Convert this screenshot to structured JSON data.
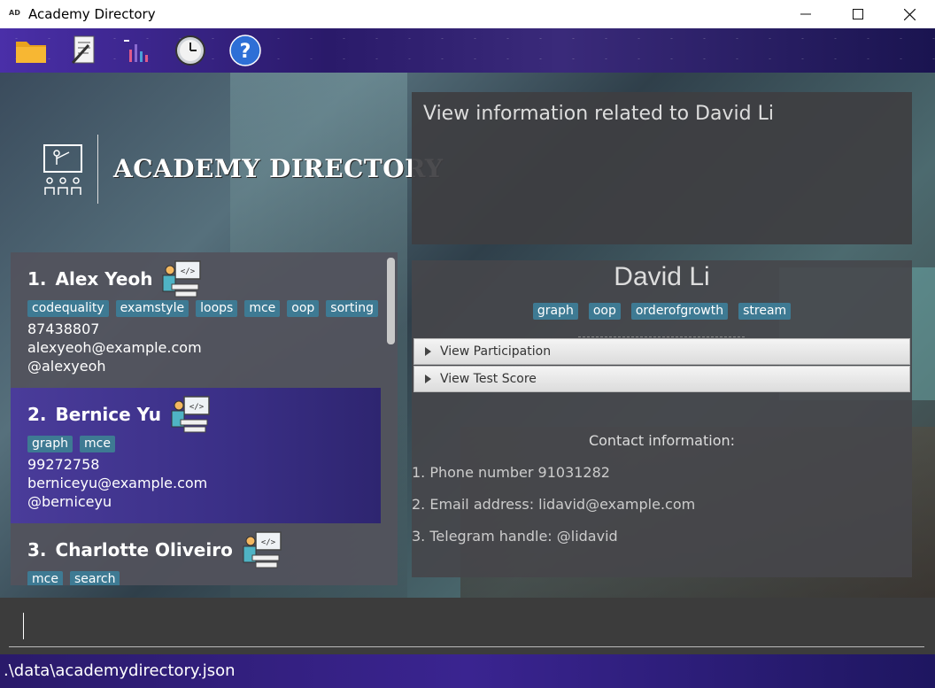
{
  "window": {
    "app_icon_text": "AD",
    "title": "Academy Directory"
  },
  "toolbar": {
    "items": [
      {
        "icon": "folder-icon"
      },
      {
        "icon": "notes-icon"
      },
      {
        "icon": "chart-icon"
      },
      {
        "icon": "clock-icon"
      },
      {
        "icon": "help-icon"
      }
    ]
  },
  "logo": {
    "text": "ACADEMY DIRECTORY"
  },
  "students": [
    {
      "index": "1.",
      "name": "Alex Yeoh",
      "tags": [
        "codequality",
        "examstyle",
        "loops",
        "mce",
        "oop",
        "sorting"
      ],
      "phone": "87438807",
      "email": "alexyeoh@example.com",
      "telegram": "@alexyeoh",
      "selected": false
    },
    {
      "index": "2.",
      "name": "Bernice Yu",
      "tags": [
        "graph",
        "mce"
      ],
      "phone": "99272758",
      "email": "berniceyu@example.com",
      "telegram": "@berniceyu",
      "selected": true
    },
    {
      "index": "3.",
      "name": "Charlotte Oliveiro",
      "tags": [
        "mce",
        "search"
      ],
      "phone": "",
      "email": "",
      "telegram": "",
      "selected": false
    }
  ],
  "info_panel": {
    "text": "View information related to David Li"
  },
  "detail": {
    "name": "David Li",
    "tags": [
      "graph",
      "oop",
      "orderofgrowth",
      "stream"
    ],
    "accordions": [
      "View Participation",
      "View Test Score"
    ],
    "contact_heading": "Contact information:",
    "contact_lines": [
      "1. Phone number 91031282",
      "2. Email address: lidavid@example.com",
      "3. Telegram handle: @lidavid"
    ]
  },
  "command_box": {
    "value": ""
  },
  "status_bar": {
    "path": ".\\data\\academydirectory.json"
  },
  "colors": {
    "tag_bg": "#3e7a93",
    "selected_card": "#3a2f86",
    "toolbar_accent": "#4a2fa8"
  }
}
